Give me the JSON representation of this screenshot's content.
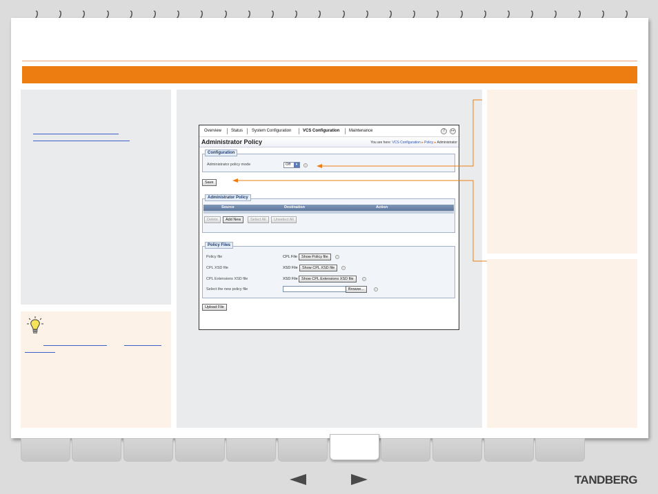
{
  "colors": {
    "accent": "#ee7d11",
    "panel_grey": "#eaebec",
    "panel_cream": "#fcf2e8",
    "link_blue": "#3b5dc9",
    "arrow_dark": "#4a4a4a"
  },
  "screenshot": {
    "nav": {
      "items": [
        "Overview",
        "Status",
        "System Configuration",
        "VCS Configuration",
        "Maintenance"
      ],
      "active": "VCS Configuration",
      "help_icon": "help-icon",
      "logout_icon": "logout-icon"
    },
    "title": "Administrator Policy",
    "breadcrumb": {
      "prefix": "You are here:",
      "items": [
        "VCS Configuration",
        "Policy",
        "Administrator"
      ]
    },
    "configuration": {
      "label": "Configuration",
      "mode_label": "Administrator policy mode",
      "mode_value": "Off"
    },
    "save_label": "Save",
    "policy_section": {
      "label": "Administrator Policy",
      "columns": [
        "Source",
        "Destination",
        "Action"
      ],
      "buttons": {
        "delete": "Delete",
        "add_new": "Add New",
        "select_all": "Select All",
        "unselect_all": "Unselect All"
      }
    },
    "policy_files": {
      "label": "Policy Files",
      "rows": [
        {
          "label": "Policy file",
          "type": "CPL File",
          "button": "Show Policy file"
        },
        {
          "label": "CPL XSD file",
          "type": "XSD File",
          "button": "Show CPL XSD file"
        },
        {
          "label": "CPL Extensions XSD file",
          "type": "XSD File",
          "button": "Show CPL Extensions XSD file"
        }
      ],
      "select_label": "Select the new policy file",
      "browse_label": "Browse..."
    },
    "upload_label": "Upload File"
  },
  "brand": "TANDBERG"
}
